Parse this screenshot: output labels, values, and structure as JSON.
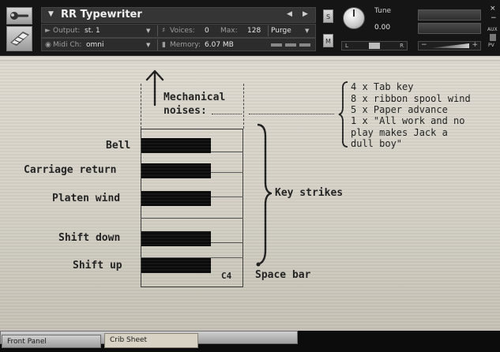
{
  "header": {
    "instrument_title": "RR Typewriter",
    "output_label": "Output:",
    "output_value": "st. 1",
    "voices_label": "Voices:",
    "voices_value": "0",
    "max_label": "Max:",
    "max_value": "128",
    "purge_label": "Purge",
    "midi_label": "Midi Ch:",
    "midi_value": "omni",
    "memory_label": "Memory:",
    "memory_value": "6.07 MB",
    "solo_label": "S",
    "mute_label": "M",
    "tune_label": "Tune",
    "tune_value": "0.00",
    "pan_left": "L",
    "pan_right": "R",
    "vol_minus": "−",
    "vol_plus": "+",
    "close_glyph": "×",
    "minimize_glyph": "−",
    "aux_label": "AUX",
    "pv_label": "PV"
  },
  "sheet": {
    "noises_title": "Mechanical",
    "noises_sub": "noises:",
    "noise_list": [
      "4 x Tab key",
      "8 x ribbon spool wind",
      "5 x Paper advance",
      "1 x \"All work and no",
      "play makes Jack a",
      "dull boy\""
    ],
    "key_labels": {
      "bell": "Bell",
      "carriage_return": "Carriage return",
      "platen_wind": "Platen wind",
      "shift_down": "Shift down",
      "shift_up": "Shift up"
    },
    "c4_label": "C4",
    "key_strikes": "Key strikes",
    "space_bar": "Space bar"
  },
  "tabs": {
    "front_panel": "Front Panel",
    "crib_sheet": "Crib Sheet"
  },
  "colors": {
    "paper": "#d8d4c9",
    "ink": "#1d1d1d",
    "header_bg": "#151515"
  }
}
